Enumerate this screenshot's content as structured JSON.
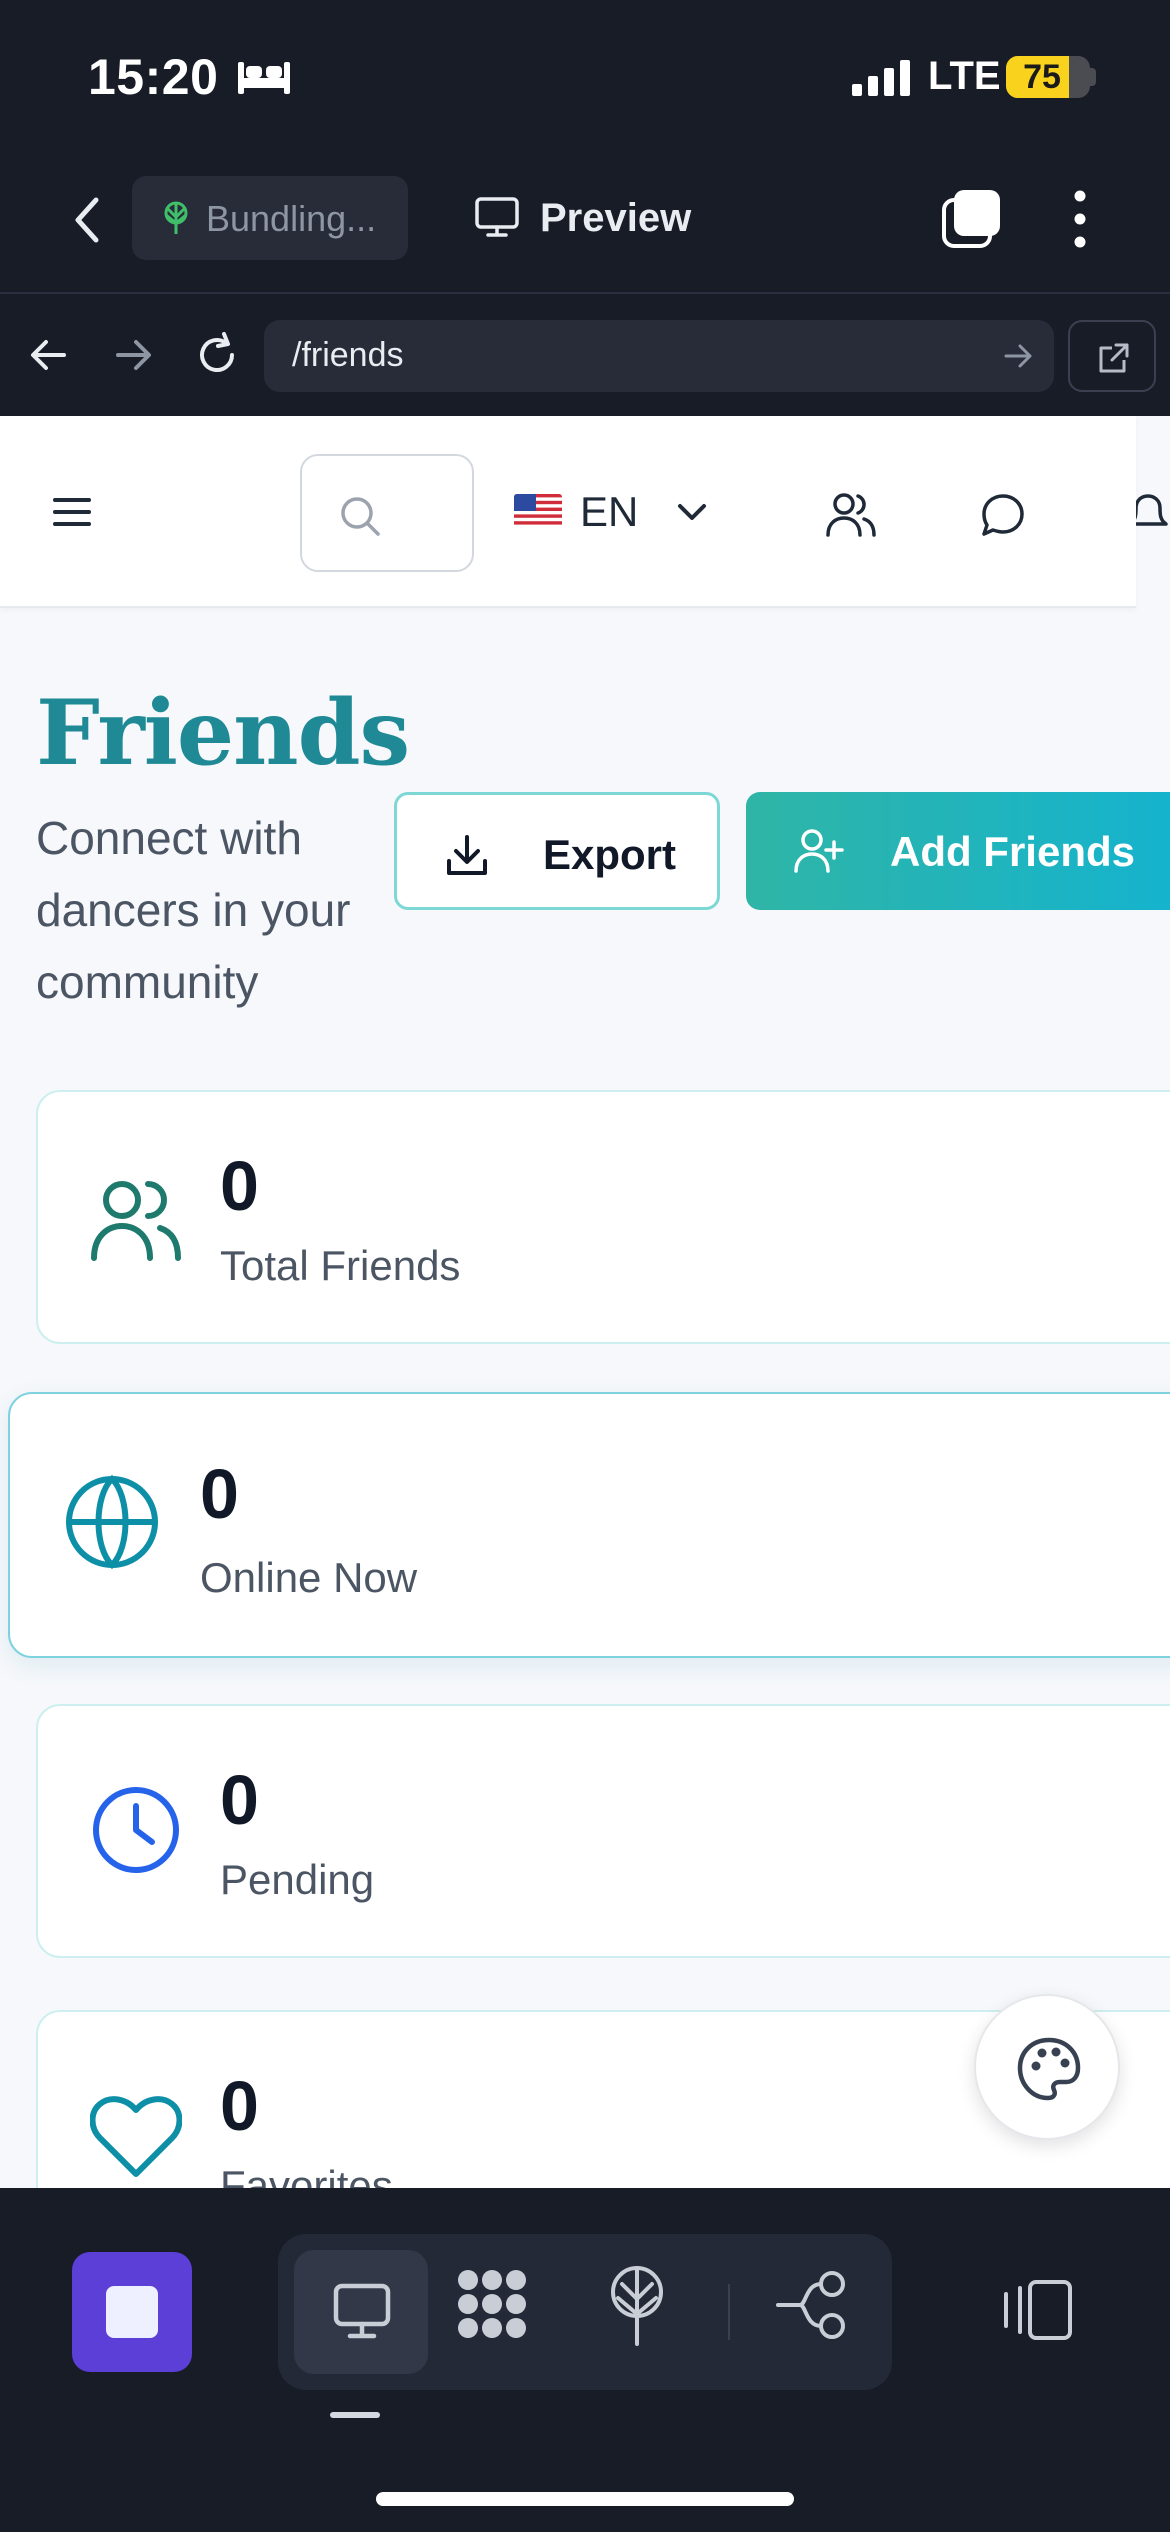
{
  "status_bar": {
    "time": "15:20",
    "network": "LTE",
    "battery_percent": "75",
    "battery_level": 0.75,
    "icons": [
      "bed-icon",
      "signal-icon"
    ]
  },
  "editor_bar": {
    "build_status": "Bundling...",
    "preview_label": "Preview",
    "icons": [
      "back-icon",
      "tree-icon",
      "monitor-icon",
      "tabs-icon",
      "more-icon"
    ]
  },
  "url_bar": {
    "path": "/friends",
    "icons": [
      "arrow-left-icon",
      "arrow-right-icon",
      "reload-icon",
      "go-arrow-icon",
      "external-link-icon"
    ]
  },
  "site_header": {
    "language_code": "EN",
    "icons": [
      "menu-icon",
      "search-icon",
      "us-flag-icon",
      "chevron-down-icon",
      "users-icon",
      "message-icon",
      "bell-icon"
    ]
  },
  "page": {
    "title": "Friends",
    "subtitle": "Connect with dancers in your community",
    "export_label": "Export",
    "add_friends_label": "Add Friends"
  },
  "stats": [
    {
      "value": "0",
      "label": "Total Friends",
      "icon": "users-icon",
      "color": "#1f7a6e"
    },
    {
      "value": "0",
      "label": "Online Now",
      "icon": "globe-icon",
      "color": "#0e8fa8"
    },
    {
      "value": "0",
      "label": "Pending",
      "icon": "clock-icon",
      "color": "#2563eb"
    },
    {
      "value": "0",
      "label": "Favorites",
      "icon": "heart-icon",
      "color": "#0e8fa8"
    }
  ],
  "colors": {
    "title_teal": "#1f8a95",
    "accent_gradient_start": "#2fb5a6",
    "accent_gradient_end": "#14b3cf",
    "stop_purple": "#5b3fd6",
    "chrome_dark": "#181c27"
  },
  "bottom_toolbar": {
    "icons": [
      "stop-icon",
      "desktop-icon",
      "components-icon",
      "deploy-icon",
      "flow-icon",
      "sidebar-toggle-icon"
    ]
  }
}
